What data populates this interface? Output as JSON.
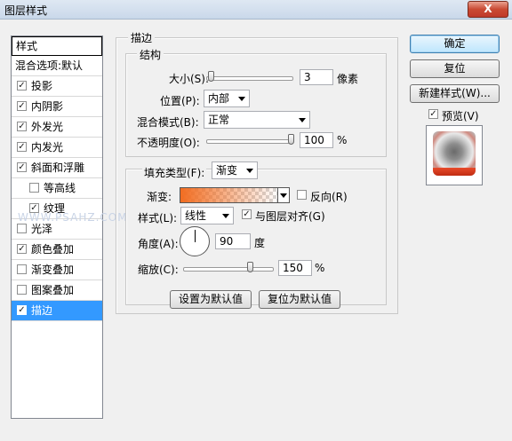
{
  "window": {
    "title": "图层样式",
    "close_label": "X"
  },
  "styles_panel": {
    "header": "样式",
    "items": [
      {
        "label": "混合选项:默认",
        "checked": null,
        "indent": false,
        "selected": false
      },
      {
        "label": "投影",
        "checked": true,
        "indent": false,
        "selected": false
      },
      {
        "label": "内阴影",
        "checked": true,
        "indent": false,
        "selected": false
      },
      {
        "label": "外发光",
        "checked": true,
        "indent": false,
        "selected": false
      },
      {
        "label": "内发光",
        "checked": true,
        "indent": false,
        "selected": false
      },
      {
        "label": "斜面和浮雕",
        "checked": true,
        "indent": false,
        "selected": false
      },
      {
        "label": "等高线",
        "checked": false,
        "indent": true,
        "selected": false
      },
      {
        "label": "纹理",
        "checked": true,
        "indent": true,
        "selected": false
      },
      {
        "label": "光泽",
        "checked": false,
        "indent": false,
        "selected": false
      },
      {
        "label": "颜色叠加",
        "checked": true,
        "indent": false,
        "selected": false
      },
      {
        "label": "渐变叠加",
        "checked": false,
        "indent": false,
        "selected": false
      },
      {
        "label": "图案叠加",
        "checked": false,
        "indent": false,
        "selected": false
      },
      {
        "label": "描边",
        "checked": true,
        "indent": false,
        "selected": true
      }
    ]
  },
  "stroke": {
    "group_title": "描边",
    "structure": {
      "group_title": "结构",
      "size_label": "大小(S):",
      "size_value": "3",
      "size_unit": "像素",
      "size_fraction": 0.02,
      "position_label": "位置(P):",
      "position_value": "内部",
      "blend_label": "混合模式(B):",
      "blend_value": "正常",
      "opacity_label": "不透明度(O):",
      "opacity_value": "100",
      "opacity_unit": "%",
      "opacity_fraction": 1.0
    },
    "fill": {
      "type_label": "填充类型(F):",
      "type_value": "渐变",
      "gradient_label": "渐变:",
      "reverse_label": "反向(R)",
      "reverse_checked": false,
      "style_label": "样式(L):",
      "style_value": "线性",
      "align_label": "与图层对齐(G)",
      "align_checked": true,
      "angle_label": "角度(A):",
      "angle_value": "90",
      "angle_unit": "度",
      "scale_label": "缩放(C):",
      "scale_value": "150",
      "scale_unit": "%",
      "scale_fraction": 0.75
    },
    "set_default_label": "设置为默认值",
    "reset_default_label": "复位为默认值"
  },
  "actions": {
    "ok_label": "确定",
    "reset_label": "复位",
    "new_style_label": "新建样式(W)...",
    "preview_label": "预览(V)",
    "preview_checked": true
  },
  "watermark": "WWW.PSAHZ.COM"
}
